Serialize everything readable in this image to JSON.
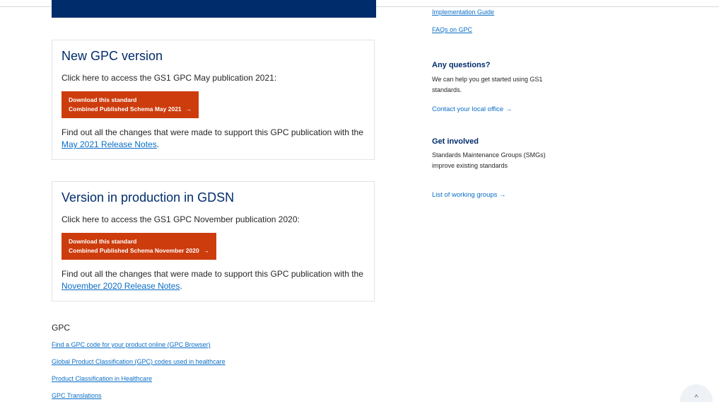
{
  "cards": [
    {
      "title": "New GPC version",
      "intro": "Click here to access the GS1 GPC May publication 2021:",
      "button_line1": "Download this standard",
      "button_line2": "Combined Published Schema May 2021",
      "note_prefix": "Find out all the changes that were made to support this GPC publication with the ",
      "note_link": "May 2021 Release Notes",
      "note_suffix": "."
    },
    {
      "title": "Version in production in GDSN",
      "intro": "Click here to access the GS1 GPC November publication 2020:",
      "button_line1": "Download this standard",
      "button_line2": "Combined Published Schema November 2020",
      "note_prefix": "Find out all the changes that were made to support this GPC publication with the ",
      "note_link": "November 2020 Release Notes",
      "note_suffix": "."
    }
  ],
  "gpc_section": {
    "heading": "GPC",
    "links": [
      "Find a GPC code for your product online (GPC Browser)",
      "Global Product Classification (GPC) codes used in healthcare",
      "Product Classification in Healthcare",
      "GPC Translations"
    ]
  },
  "sidebar": {
    "implementation_guide": "Implementation Guide",
    "faqs": "FAQs on GPC",
    "questions_heading": "Any questions?",
    "questions_text": "We can help you get started using GS1 standards.",
    "contact_link": "Contact your local office",
    "involved_heading": "Get involved",
    "involved_text": "Standards Maintenance Groups (SMGs) improve existing standards",
    "working_groups_link": "List of working groups"
  },
  "icons": {
    "arrow": "→",
    "scroll_top": "^"
  },
  "colors": {
    "brand_navy": "#002c6c",
    "button_orange": "#cd3c0d",
    "link_blue": "#0b6ec7"
  }
}
